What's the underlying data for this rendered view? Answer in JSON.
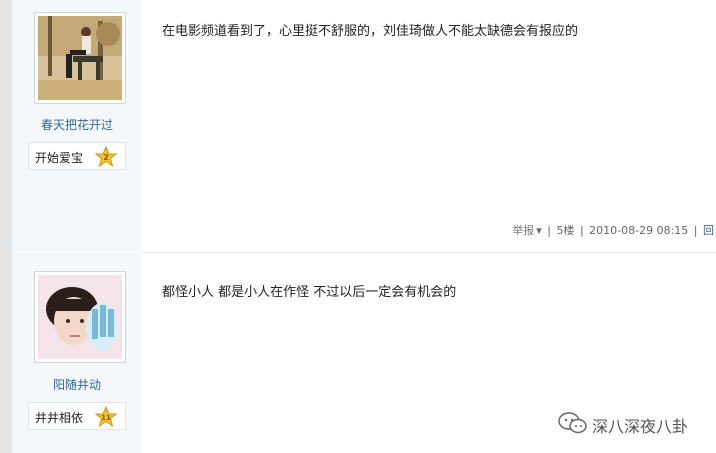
{
  "posts": [
    {
      "username": "春天把花开过",
      "rank_label": "开始爱宝",
      "rank_level": "2",
      "content": "在电影频道看到了，心里挺不舒服的，刘佳琦做人不能太缺德会有报应的",
      "report_label": "举报",
      "floor": "5楼",
      "timestamp": "2010-08-29 08:15",
      "reply_label": "回"
    },
    {
      "username": "阳随井动",
      "rank_label": "井井相依",
      "rank_level": "11",
      "content": "都怪小人 都是小人在作怪 不过以后一定会有机会的"
    }
  ],
  "watermark": "深八深夜八卦",
  "colors": {
    "username": "#336699",
    "sidebar_bg": "#f5f8fb",
    "badge_star": "#f2c230"
  },
  "icons": [
    "star-badge-icon",
    "star-badge-icon",
    "wechat-icon"
  ]
}
